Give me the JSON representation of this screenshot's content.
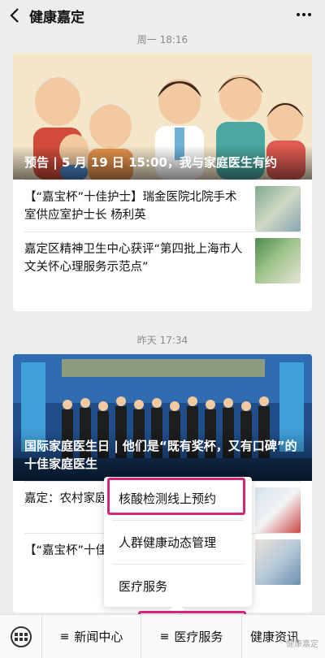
{
  "header": {
    "back_icon": "chevron-left-icon",
    "title": "健康嘉定",
    "more_icon": "more-dots-icon"
  },
  "timestamps": [
    "周一 18:16",
    "昨天 17:34"
  ],
  "card1": {
    "hero_caption": "预告 | 5 月 19 日 15:00，我与家庭医生有约",
    "items": [
      {
        "text": "【“嘉宝杯”十佳护士】瑞金医院北院手术室供应室护士长 杨利英"
      },
      {
        "text": "嘉定区精神卫生中心获评“第四批上海市人文关怀心理服务示范点”"
      }
    ]
  },
  "card2": {
    "hero_caption": "国际家庭医生日 | 他们是“既有奖杯，又有口碑”的十佳家庭医生",
    "items": [
      {
        "text": "嘉定：农村家庭...疫情"
      },
      {
        "text": "【“嘉宝杯”十佳...二病区主管护师..."
      }
    ]
  },
  "popup_menu": {
    "items": [
      "核酸检测线上预约",
      "人群健康动态管理",
      "医疗服务"
    ]
  },
  "bottom_menu": {
    "keyboard_icon": "keyboard-icon",
    "items": [
      "新闻中心",
      "医疗服务",
      "健康资讯"
    ],
    "hamburger": "≡"
  },
  "watermark": "健康嘉定",
  "colors": {
    "highlight": "#d2287a",
    "background": "#ededed"
  }
}
